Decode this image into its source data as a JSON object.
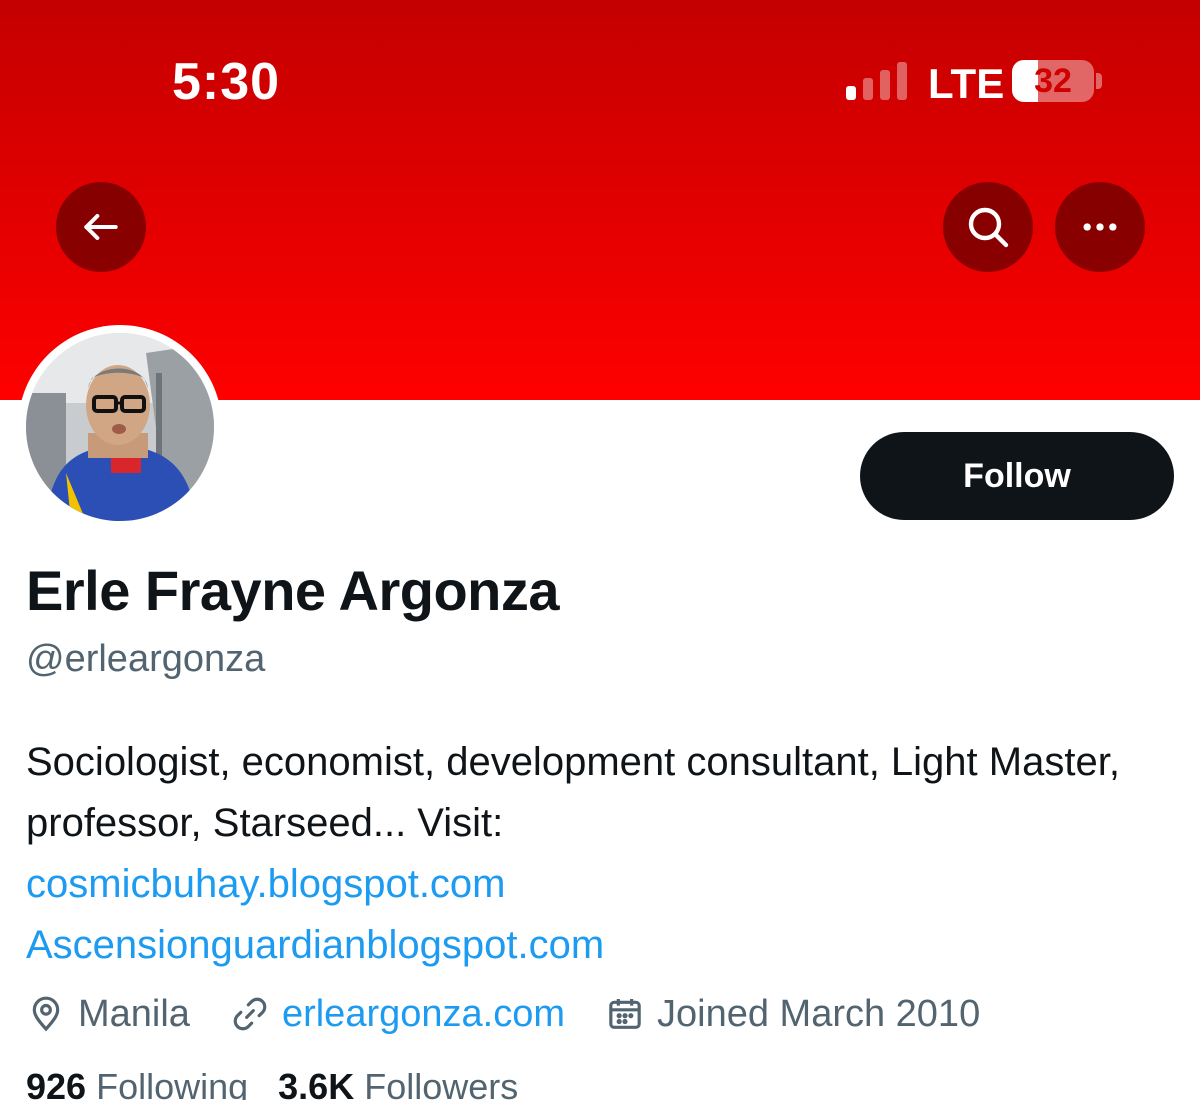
{
  "status_bar": {
    "time": "5:30",
    "network": "LTE",
    "battery": "32",
    "battery_level": 0.32
  },
  "header": {
    "back_icon": "arrow-left-icon",
    "search_icon": "search-icon",
    "more_icon": "more-horizontal-icon",
    "banner_color": "#e30000"
  },
  "profile": {
    "display_name": "Erle Frayne Argonza",
    "handle": "@erleargonza",
    "follow_label": "Follow",
    "bio_text": "Sociologist, economist, development consultant, Light Master, professor, Starseed... Visit:",
    "bio_links": [
      "cosmicbuhay.blogspot.com",
      "Ascensionguardianblogspot.com"
    ],
    "location": "Manila",
    "website": "erleargonza.com",
    "joined": "Joined March 2010",
    "following_count": "926",
    "following_label": "Following",
    "followers_count": "3.6K",
    "followers_label": "Followers"
  },
  "colors": {
    "accent": "#1d9bf0",
    "text_primary": "#0f1419",
    "text_secondary": "#536471",
    "button_bg": "#0f1419"
  }
}
